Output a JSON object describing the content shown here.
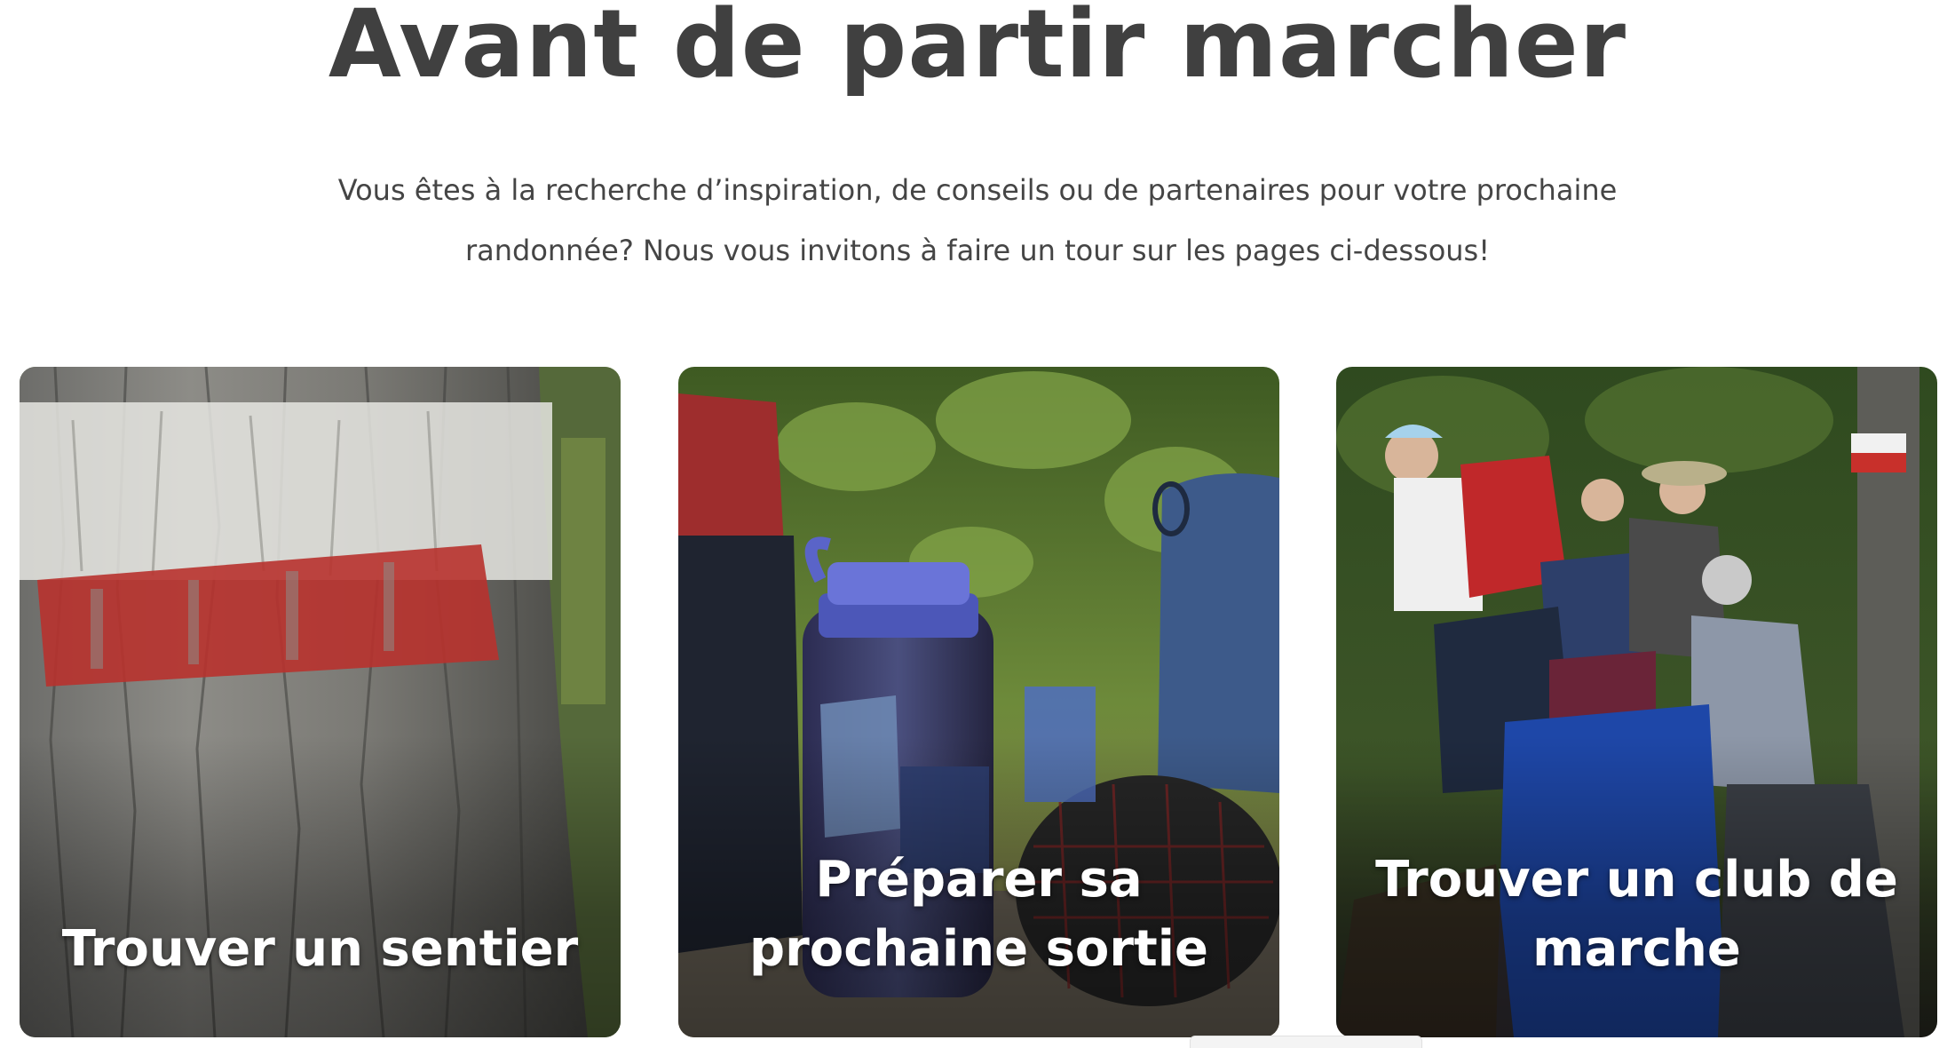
{
  "section": {
    "title": "Avant de partir marcher",
    "intro": "Vous êtes à la recherche d’inspiration, de conseils ou de partenaires pour votre prochaine randonnée? Nous vous invitons à faire un tour sur les pages ci-dessous!"
  },
  "cards": [
    {
      "label": "Trouver un sentier",
      "image": "tree-trail-marker-photo"
    },
    {
      "label": "Préparer sa prochaine sortie",
      "image": "hiking-gear-water-bottle-photo"
    },
    {
      "label": "Trouver un club de marche",
      "image": "hiking-group-backpacks-photo"
    }
  ],
  "colors": {
    "title": "#404040",
    "text": "#454545",
    "card_label": "#ffffff",
    "trail_mark_red": "#b8322e"
  }
}
